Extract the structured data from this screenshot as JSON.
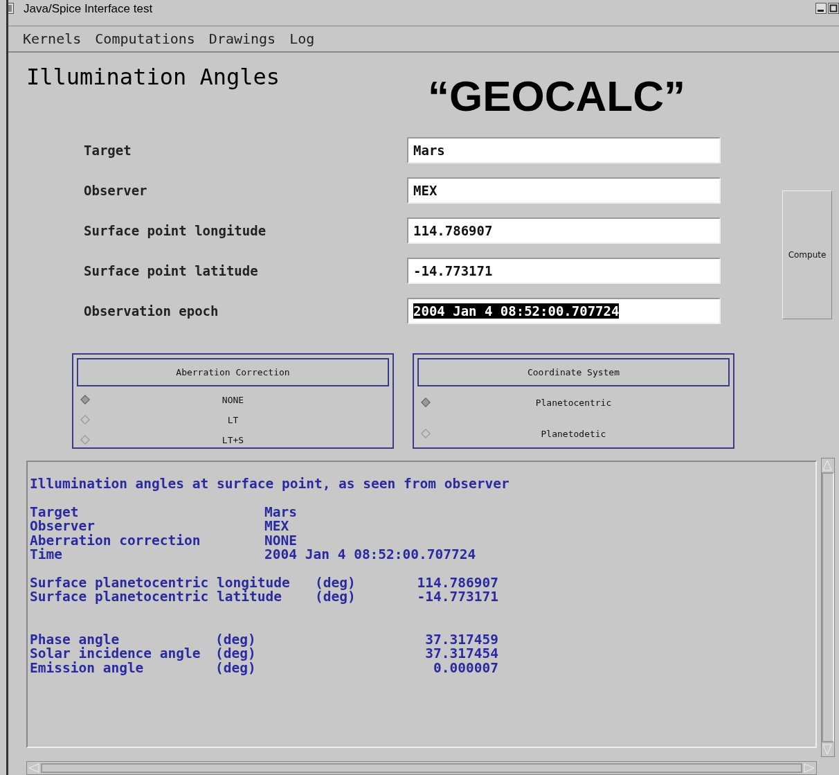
{
  "window": {
    "title": "Java/Spice Interface test"
  },
  "menu": [
    "Kernels",
    "Computations",
    "Drawings",
    "Log"
  ],
  "heading": "Illumination Angles",
  "annotation": "“GEOCALC”",
  "fields": [
    {
      "label": "Target",
      "value": "Mars",
      "text_selected": false
    },
    {
      "label": "Observer",
      "value": "MEX",
      "text_selected": false
    },
    {
      "label": "Surface point longitude",
      "value": "114.786907",
      "text_selected": false
    },
    {
      "label": "Surface point latitude",
      "value": "-14.773171",
      "text_selected": false
    },
    {
      "label": "Observation epoch",
      "value": "2004 Jan 4 08:52:00.707724",
      "text_selected": true
    }
  ],
  "compute_button": "Compute",
  "groups": [
    {
      "title": "Aberration Correction",
      "options": [
        {
          "label": "NONE",
          "selected": true
        },
        {
          "label": "LT",
          "selected": false
        },
        {
          "label": "LT+S",
          "selected": false
        }
      ]
    },
    {
      "title": "Coordinate System",
      "options": [
        {
          "label": "Planetocentric",
          "selected": true
        },
        {
          "label": "Planetodetic",
          "selected": false
        }
      ]
    }
  ],
  "output": {
    "heading": "Illumination angles at surface point, as seen from observer",
    "summary": [
      {
        "label": "Target",
        "value": "Mars"
      },
      {
        "label": "Observer",
        "value": "MEX"
      },
      {
        "label": "Aberration correction",
        "value": "NONE"
      },
      {
        "label": "Time",
        "value": "2004 Jan 4 08:52:00.707724"
      }
    ],
    "surface": [
      {
        "label": "Surface planetocentric longitude",
        "unit": "(deg)",
        "value": "114.786907"
      },
      {
        "label": "Surface planetocentric latitude",
        "unit": "(deg)",
        "value": "-14.773171"
      }
    ],
    "angles": [
      {
        "label": "Phase angle",
        "unit": "(deg)",
        "value": "37.317459"
      },
      {
        "label": "Solar incidence angle",
        "unit": "(deg)",
        "value": "37.317454"
      },
      {
        "label": "Emission angle",
        "unit": "(deg)",
        "value": "0.000007"
      }
    ]
  }
}
